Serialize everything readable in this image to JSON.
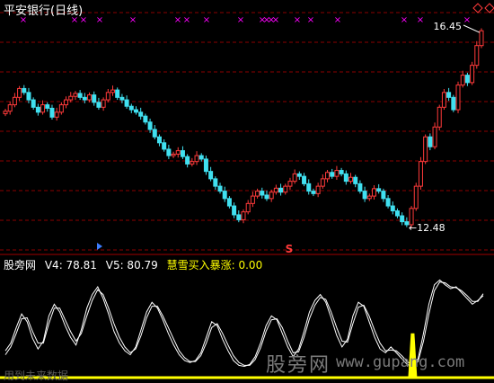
{
  "window": {
    "title": "平安银行(日线)"
  },
  "price_panel": {
    "high_label": "16.45",
    "low_label": "←12.48",
    "signal_mark": "S",
    "sell_marker": "×",
    "colors": {
      "up": "#ff3a3a",
      "down": "#40e0f0",
      "grid": "#8b0000",
      "marker": "#ff00ff",
      "s_mark": "#ff3a3a"
    }
  },
  "indicator_panel": {
    "name": "股旁网",
    "v4_label": "V4: 78.81",
    "v5_label": "V5: 80.79",
    "signal_label": "慧雪买入暴涨: 0.00",
    "colors": {
      "name": "#ffffff",
      "v4": "#ffffff",
      "v5": "#ffffff",
      "signal": "#ffff00",
      "line": "#ffffff",
      "bar": "#ffff00"
    }
  },
  "watermark": {
    "cn": "股旁网",
    "url": "www.gupang.com",
    "bottom_left": "用到未来数据"
  },
  "chart_data": [
    {
      "type": "candlestick",
      "title": "平安银行(日线)",
      "high_annotation": 16.45,
      "low_annotation": 12.48,
      "close": [
        14.82,
        14.95,
        15.1,
        15.28,
        15.2,
        15.05,
        14.9,
        14.8,
        14.95,
        14.88,
        14.7,
        14.8,
        14.95,
        15.05,
        15.12,
        15.18,
        15.1,
        15.05,
        15.15,
        15.0,
        14.9,
        15.05,
        15.2,
        15.25,
        15.1,
        15.05,
        14.92,
        14.85,
        14.8,
        14.72,
        14.6,
        14.45,
        14.3,
        14.18,
        14.05,
        13.92,
        13.95,
        14.02,
        13.9,
        13.75,
        13.8,
        13.92,
        13.85,
        13.6,
        13.45,
        13.3,
        13.2,
        13.05,
        12.9,
        12.72,
        12.62,
        12.78,
        12.95,
        13.1,
        13.2,
        13.12,
        13.05,
        13.18,
        13.26,
        13.18,
        13.3,
        13.4,
        13.55,
        13.5,
        13.35,
        13.2,
        13.15,
        13.3,
        13.45,
        13.58,
        13.5,
        13.62,
        13.55,
        13.4,
        13.48,
        13.35,
        13.2,
        13.05,
        13.1,
        13.25,
        13.2,
        13.05,
        12.9,
        12.8,
        12.7,
        12.58,
        12.52,
        12.85,
        13.3,
        13.8,
        14.3,
        14.1,
        14.5,
        14.9,
        15.2,
        15.1,
        14.85,
        15.35,
        15.55,
        15.4,
        15.75,
        16.15,
        16.45
      ],
      "ylim": [
        12.3,
        16.6
      ]
    },
    {
      "type": "line",
      "title": "股旁网",
      "series": [
        {
          "name": "V4",
          "values": [
            22,
            30,
            46,
            60,
            52,
            35,
            24,
            32,
            58,
            70,
            62,
            48,
            36,
            28,
            44,
            66,
            80,
            88,
            76,
            60,
            42,
            30,
            22,
            18,
            26,
            44,
            62,
            72,
            66,
            54,
            40,
            28,
            18,
            12,
            10,
            12,
            20,
            36,
            52,
            48,
            34,
            22,
            12,
            7,
            6,
            8,
            16,
            30,
            48,
            58,
            54,
            40,
            26,
            16,
            24,
            42,
            62,
            74,
            80,
            72,
            56,
            38,
            26,
            34,
            58,
            72,
            68,
            52,
            36,
            24,
            20,
            26,
            20,
            14,
            8,
            6,
            14,
            40,
            70,
            90,
            95,
            90,
            86,
            88,
            82,
            76,
            70,
            74,
            78.81
          ]
        },
        {
          "name": "V5",
          "values": [
            18,
            26,
            40,
            55,
            56,
            42,
            30,
            30,
            50,
            66,
            66,
            54,
            42,
            32,
            40,
            58,
            74,
            85,
            80,
            66,
            50,
            36,
            26,
            20,
            24,
            38,
            56,
            68,
            68,
            58,
            46,
            34,
            22,
            15,
            11,
            11,
            17,
            30,
            46,
            50,
            40,
            28,
            17,
            10,
            7,
            7,
            13,
            25,
            42,
            54,
            55,
            46,
            32,
            20,
            21,
            36,
            55,
            69,
            77,
            75,
            62,
            46,
            32,
            31,
            50,
            67,
            69,
            58,
            43,
            30,
            22,
            23,
            22,
            17,
            11,
            7,
            11,
            32,
            60,
            84,
            93,
            92,
            88,
            87,
            84,
            79,
            73,
            73,
            80.79
          ]
        },
        {
          "name": "慧雪买入暴涨",
          "values": [
            0,
            0,
            0,
            0,
            0,
            0,
            0,
            0,
            0,
            0,
            0,
            0,
            0,
            0,
            0,
            0,
            0,
            0,
            0,
            0,
            0,
            0,
            0,
            0,
            0,
            0,
            0,
            0,
            0,
            0,
            0,
            0,
            0,
            0,
            0,
            0,
            0,
            0,
            0,
            0,
            0,
            0,
            0,
            0,
            0,
            0,
            0,
            0,
            0,
            0,
            0,
            0,
            0,
            0,
            0,
            0,
            0,
            0,
            0,
            0,
            0,
            0,
            0,
            0,
            0,
            0,
            0,
            0,
            0,
            0,
            0,
            0,
            0,
            0,
            0,
            40,
            0,
            0,
            0,
            0,
            0,
            0,
            0,
            0,
            0,
            0,
            0,
            0,
            0.0
          ]
        }
      ],
      "ylim": [
        0,
        100
      ]
    }
  ]
}
